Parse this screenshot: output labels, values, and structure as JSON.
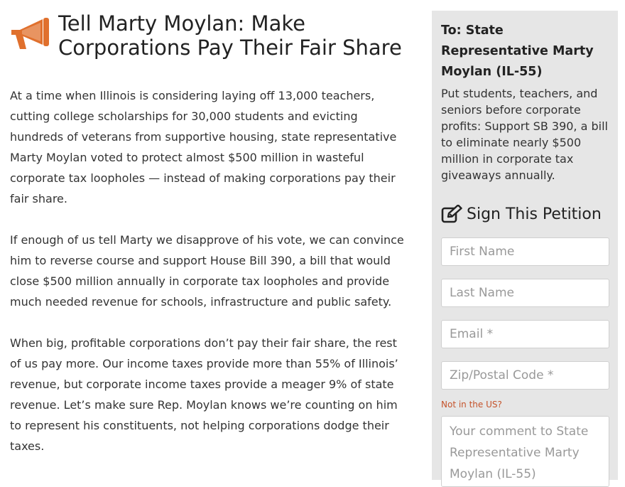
{
  "petition": {
    "title": "Tell Marty Moylan: Make Corporations Pay Their Fair Share",
    "paragraphs": [
      "At a time when Illinois is considering laying off 13,000 teachers, cutting college scholarships for 30,000 students and evicting hundreds of veterans from supportive housing, state representative Marty Moylan voted to protect almost $500 million in wasteful corporate tax loopholes — instead of making corporations pay their fair share.",
      "If enough of us tell Marty we disapprove of his vote, we can convince him to reverse course and support House Bill 390, a bill that would close $500 million annually in corporate tax loopholes and provide much needed revenue for schools, infrastructure and public safety.",
      "When big, profitable corporations don’t pay their fair share, the rest of us pay more. Our income taxes provide more than 55% of Illinois’ revenue, but corporate income taxes provide a meager 9% of state revenue. Let’s make sure Rep. Moylan knows we’re counting on him to represent his constituents, not helping corporations dodge their taxes."
    ]
  },
  "sidebar": {
    "target": "To: State Representative Marty Moylan (IL-55)",
    "summary": "Put students, teachers, and seniors before corporate profits: Support SB 390, a bill to eliminate nearly $500 million in corporate tax giveaways annually.",
    "sign_heading": "Sign This Petition",
    "fields": {
      "first_name_placeholder": "First Name",
      "last_name_placeholder": "Last Name",
      "email_placeholder": "Email *",
      "zip_placeholder": "Zip/Postal Code *",
      "comment_placeholder": "Your comment to State Representative Marty Moylan (IL-55)"
    },
    "not_in_us_label": "Not in the US?"
  },
  "icons": {
    "header": "megaphone-icon",
    "sign": "pencil-square-icon"
  },
  "colors": {
    "accent": "#e0702d",
    "link": "#c5532b",
    "sidebar_bg": "#e6e6e6"
  }
}
